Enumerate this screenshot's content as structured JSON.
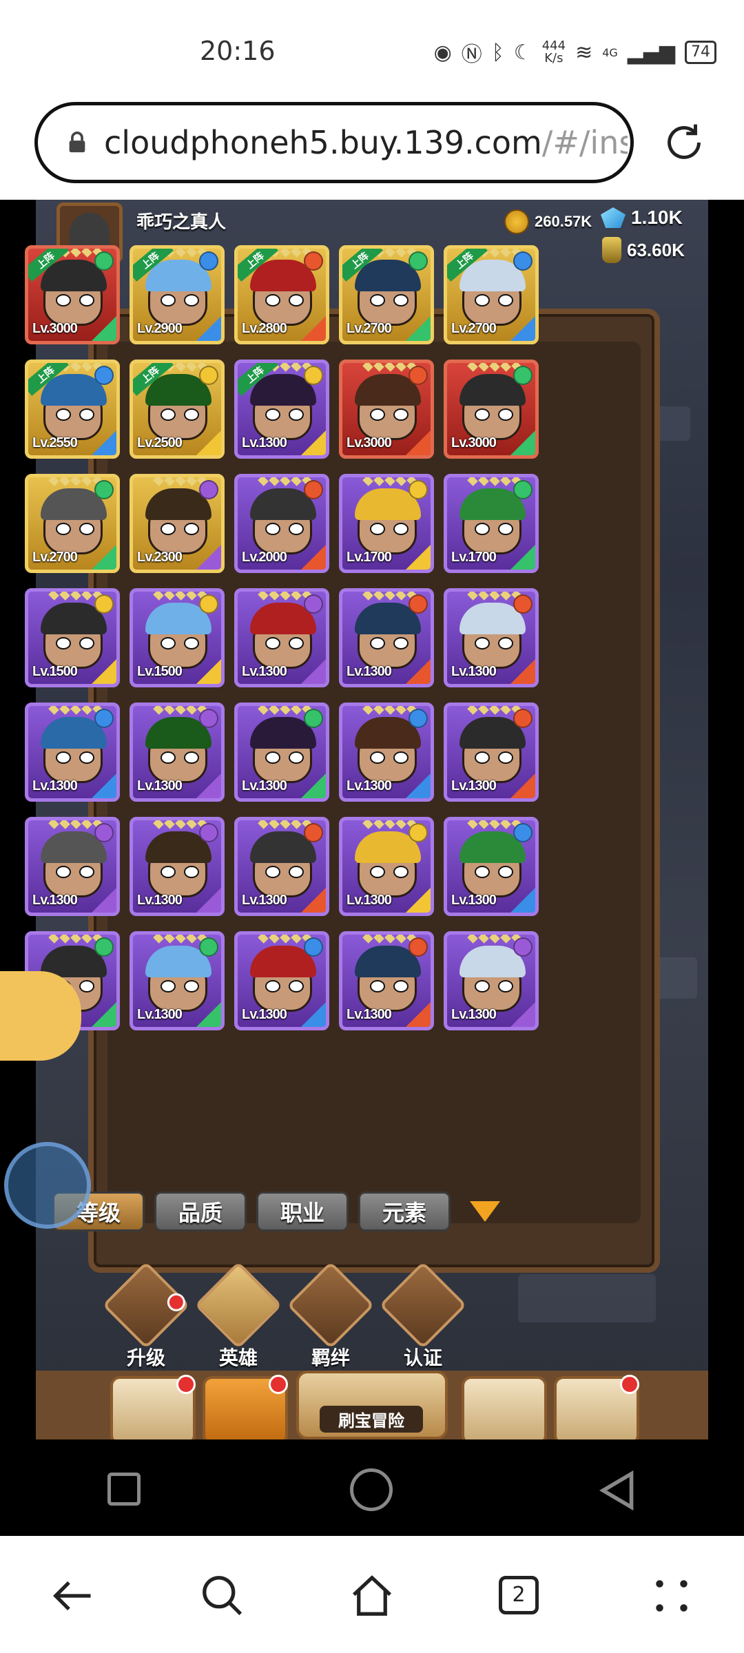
{
  "status_bar": {
    "time": "20:16",
    "net_speed": "444\nK/s",
    "signal": "4G",
    "battery": "74"
  },
  "browser": {
    "url_main": "cloudphoneh5.buy.139.com",
    "url_dim": "/#/inst",
    "tab_count": "2"
  },
  "game": {
    "player_name": "乖巧之真人",
    "gold": "260.57K",
    "gems": "1.10K",
    "potions": "63.60K",
    "heroes": [
      {
        "quality": "red",
        "level": "Lv.3000",
        "tag": "上阵",
        "element": "wind"
      },
      {
        "quality": "gold",
        "level": "Lv.2900",
        "tag": "上阵",
        "element": "water"
      },
      {
        "quality": "gold",
        "level": "Lv.2800",
        "tag": "上阵",
        "element": "fire"
      },
      {
        "quality": "gold",
        "level": "Lv.2700",
        "tag": "上阵",
        "element": "wind"
      },
      {
        "quality": "gold",
        "level": "Lv.2700",
        "tag": "上阵",
        "element": "water"
      },
      {
        "quality": "gold",
        "level": "Lv.2550",
        "tag": "上阵",
        "element": "water"
      },
      {
        "quality": "gold",
        "level": "Lv.2500",
        "tag": "上阵",
        "element": "light"
      },
      {
        "quality": "purple",
        "level": "Lv.1300",
        "tag": "上阵",
        "element": "light"
      },
      {
        "quality": "red",
        "level": "Lv.3000",
        "tag": "",
        "element": "fire"
      },
      {
        "quality": "red",
        "level": "Lv.3000",
        "tag": "",
        "element": "wind"
      },
      {
        "quality": "gold",
        "level": "Lv.2700",
        "tag": "",
        "element": "wind"
      },
      {
        "quality": "gold",
        "level": "Lv.2300",
        "tag": "",
        "element": "dark"
      },
      {
        "quality": "purple",
        "level": "Lv.2000",
        "tag": "",
        "element": "fire"
      },
      {
        "quality": "purple",
        "level": "Lv.1700",
        "tag": "",
        "element": "light"
      },
      {
        "quality": "purple",
        "level": "Lv.1700",
        "tag": "",
        "element": "wind"
      },
      {
        "quality": "purple",
        "level": "Lv.1500",
        "tag": "",
        "element": "light"
      },
      {
        "quality": "purple",
        "level": "Lv.1500",
        "tag": "",
        "element": "light"
      },
      {
        "quality": "purple",
        "level": "Lv.1300",
        "tag": "",
        "element": "dark"
      },
      {
        "quality": "purple",
        "level": "Lv.1300",
        "tag": "",
        "element": "fire"
      },
      {
        "quality": "purple",
        "level": "Lv.1300",
        "tag": "",
        "element": "fire"
      },
      {
        "quality": "purple",
        "level": "Lv.1300",
        "tag": "",
        "element": "water"
      },
      {
        "quality": "purple",
        "level": "Lv.1300",
        "tag": "",
        "element": "dark"
      },
      {
        "quality": "purple",
        "level": "Lv.1300",
        "tag": "",
        "element": "wind"
      },
      {
        "quality": "purple",
        "level": "Lv.1300",
        "tag": "",
        "element": "water"
      },
      {
        "quality": "purple",
        "level": "Lv.1300",
        "tag": "",
        "element": "fire"
      },
      {
        "quality": "purple",
        "level": "Lv.1300",
        "tag": "",
        "element": "dark"
      },
      {
        "quality": "purple",
        "level": "Lv.1300",
        "tag": "",
        "element": "dark"
      },
      {
        "quality": "purple",
        "level": "Lv.1300",
        "tag": "",
        "element": "fire"
      },
      {
        "quality": "purple",
        "level": "Lv.1300",
        "tag": "",
        "element": "light"
      },
      {
        "quality": "purple",
        "level": "Lv.1300",
        "tag": "",
        "element": "water"
      },
      {
        "quality": "purple",
        "level": "Lv.1300",
        "tag": "",
        "element": "wind"
      },
      {
        "quality": "purple",
        "level": "Lv.1300",
        "tag": "",
        "element": "wind"
      },
      {
        "quality": "purple",
        "level": "Lv.1300",
        "tag": "",
        "element": "water"
      },
      {
        "quality": "purple",
        "level": "Lv.1300",
        "tag": "",
        "element": "fire"
      },
      {
        "quality": "purple",
        "level": "Lv.1300",
        "tag": "",
        "element": "dark"
      }
    ],
    "filters": [
      "等级",
      "品质",
      "职业",
      "元素"
    ],
    "nav": [
      {
        "label": "升级",
        "badge": true
      },
      {
        "label": "英雄",
        "badge": false
      },
      {
        "label": "羁绊",
        "badge": false
      },
      {
        "label": "认证",
        "badge": false
      }
    ],
    "bottom_tab_center": "刷宝冒险"
  },
  "colors": {
    "wind": "#35c26a",
    "water": "#3a8ee8",
    "fire": "#e8562e",
    "light": "#f2c535",
    "dark": "#9a5ad8"
  }
}
